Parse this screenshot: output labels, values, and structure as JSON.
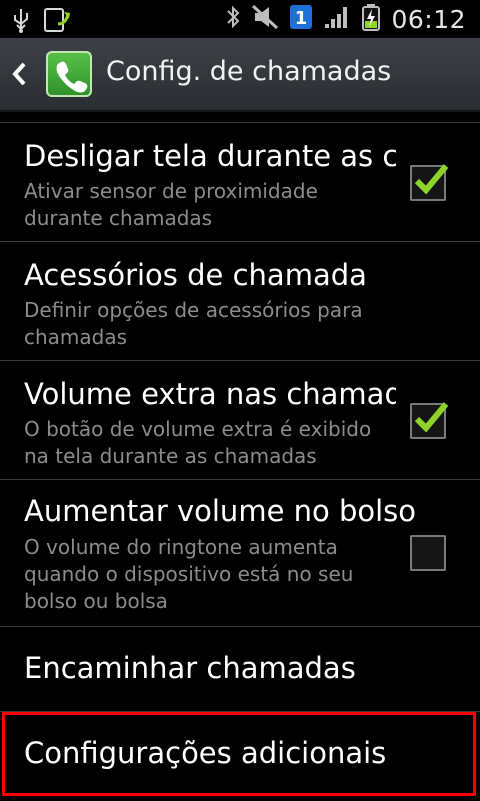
{
  "status_bar": {
    "time": "06:12",
    "left_icons": [
      "usb-icon",
      "upload-icon"
    ],
    "right_icons": [
      "bluetooth-icon",
      "mute-icon",
      "notification-badge-icon",
      "signal-icon",
      "battery-charging-icon"
    ],
    "badge_number": "1"
  },
  "action_bar": {
    "title": "Config. de chamadas",
    "app_icon": "phone-icon"
  },
  "settings": [
    {
      "title": "Desligar tela durante as chamadas",
      "summary": "Ativar sensor de proximidade durante chamadas",
      "checkbox": true,
      "checked": true
    },
    {
      "title": "Acessórios de chamada",
      "summary": "Definir opções de acessórios para chamadas",
      "checkbox": false
    },
    {
      "title": "Volume extra nas chamadas",
      "summary": "O botão de volume extra é exibido na tela durante as chamadas",
      "checkbox": true,
      "checked": true
    },
    {
      "title": "Aumentar volume no bolso",
      "summary": "O volume do ringtone aumenta quando o dispositivo está no seu bolso ou bolsa",
      "checkbox": true,
      "checked": false
    },
    {
      "title": "Encaminhar chamadas"
    },
    {
      "title": "Configurações adicionais"
    }
  ],
  "colors": {
    "accent_check": "#8ed32a",
    "highlight": "#ff0000"
  }
}
